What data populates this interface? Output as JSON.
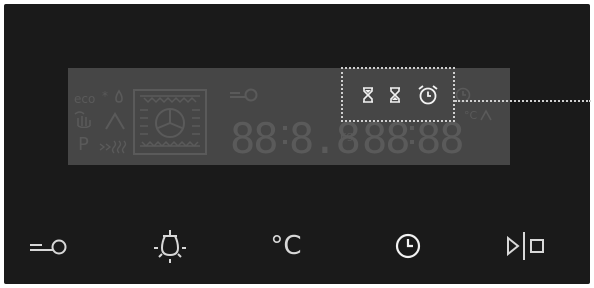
{
  "display": {
    "mode_labels": {
      "eco": "eco",
      "p": "P"
    },
    "weight_unit": "kg",
    "temp_unit": "°C",
    "digits_left": "88",
    "digits_left2": "8.8",
    "digits_right": "88",
    "digits_right2": "88",
    "timer_icons": [
      "hourglass-start-icon",
      "hourglass-end-icon",
      "alarm-clock-icon"
    ]
  },
  "buttons": [
    {
      "name": "lock-button",
      "icon": "key-lock-icon"
    },
    {
      "name": "light-button",
      "icon": "oven-light-icon"
    },
    {
      "name": "temperature-button",
      "label": "°C"
    },
    {
      "name": "timer-button",
      "icon": "clock-icon"
    },
    {
      "name": "start-stop-button",
      "icon": "play-stop-icon"
    }
  ],
  "colors": {
    "panel_bg": "#1a1a1a",
    "display_bg": "#464646",
    "lit_icon": "#f2f2f2",
    "dim_segment": "#5a5a5a",
    "button_icon": "#d8d8d8"
  }
}
